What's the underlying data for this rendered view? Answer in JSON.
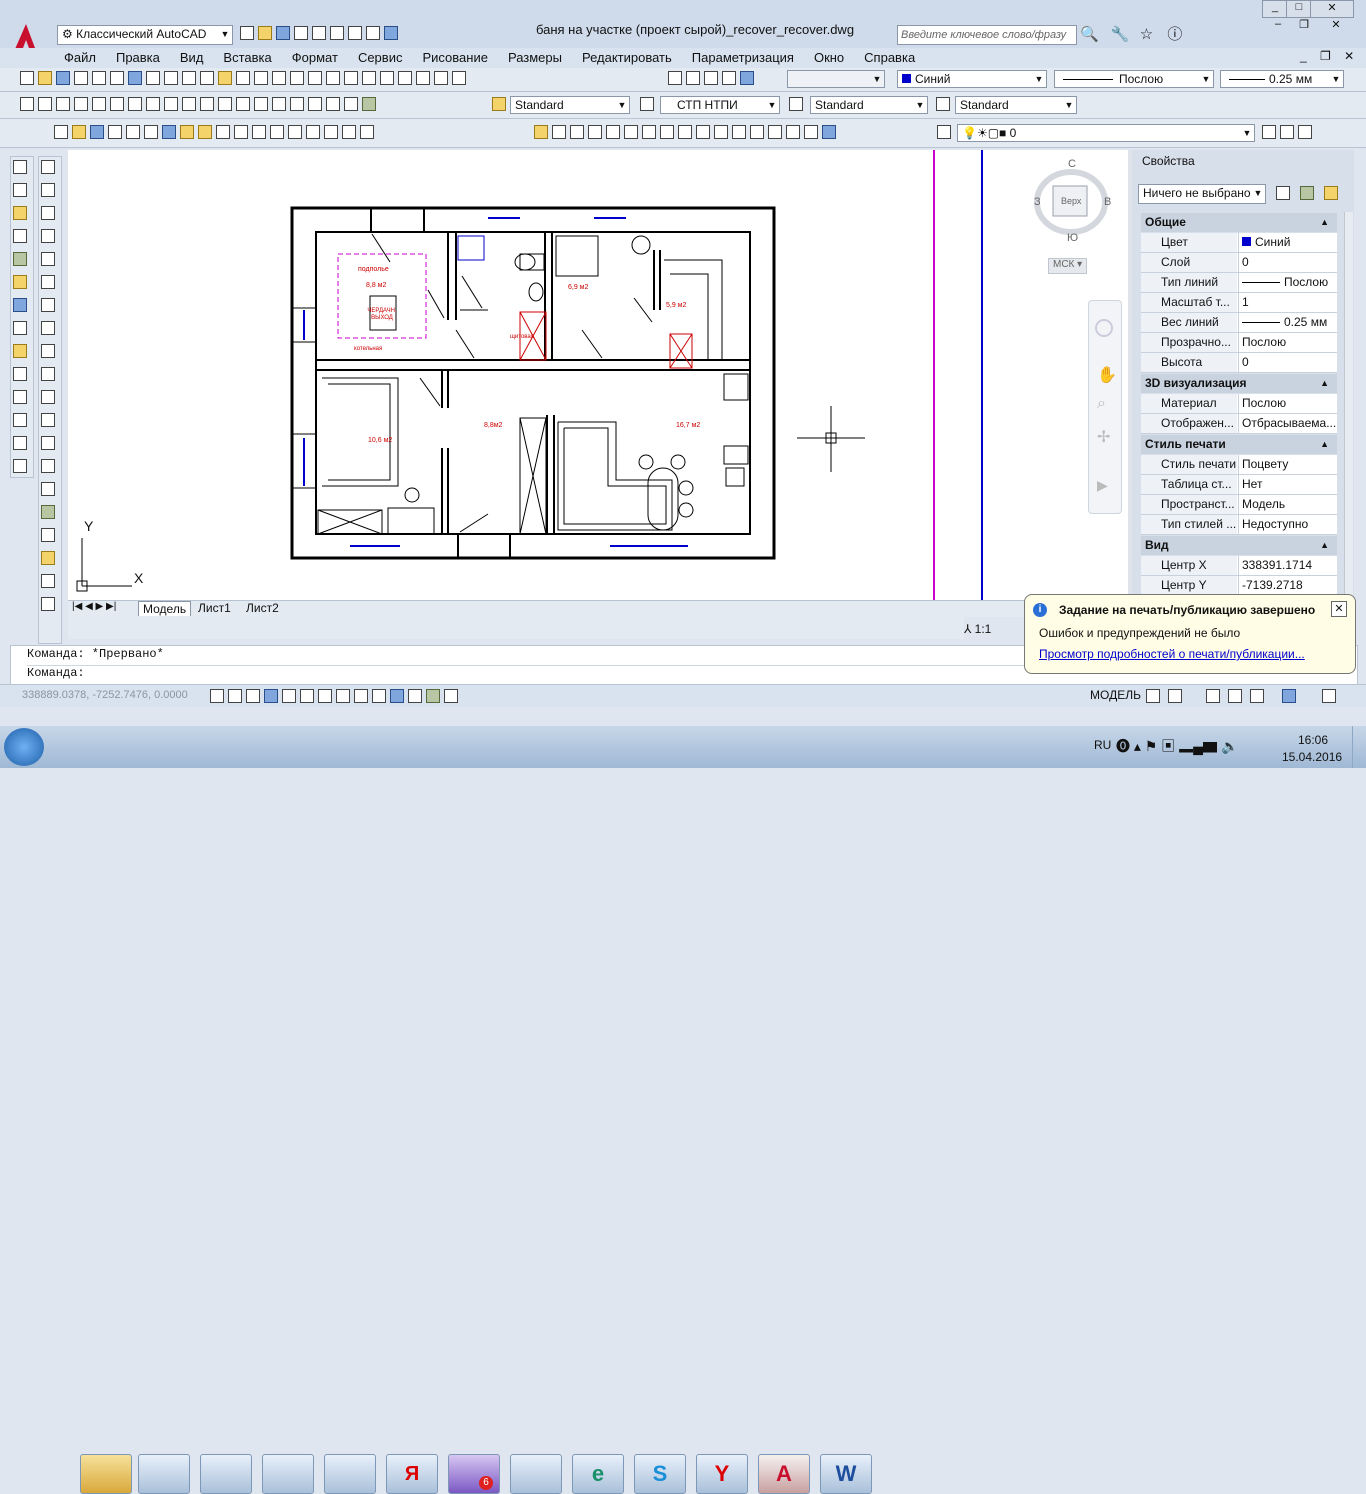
{
  "window": {
    "title": "баня на участке (проект сырой)_recover_recover.dwg",
    "workspace": "Классический AutoCAD",
    "search_placeholder": "Введите ключевое слово/фразу"
  },
  "menu": [
    "Файл",
    "Правка",
    "Вид",
    "Вставка",
    "Формат",
    "Сервис",
    "Рисование",
    "Размеры",
    "Редактировать",
    "Параметризация",
    "Окно",
    "Справка"
  ],
  "props_toolbar": {
    "color": "Синий",
    "linetype": "Послою",
    "lineweight": "0.25 мм"
  },
  "styles_toolbar": {
    "text_style": "Standard",
    "dim_style": "СТП НТПИ",
    "table_style": "Standard",
    "mleader_style": "Standard"
  },
  "layer_toolbar": {
    "layer": "0"
  },
  "tabs": [
    "Модель",
    "Лист1",
    "Лист2"
  ],
  "viewcube": {
    "north": "С",
    "south": "Ю",
    "west": "З",
    "east": "В",
    "top": "Верх",
    "ucs": "МСК"
  },
  "ucs": {
    "x": "X",
    "y": "Y"
  },
  "annotation_scale": "1:1",
  "drawing_labels": {
    "podpolie": "подполье",
    "area1": "8,8 м2",
    "hatch": "ЧЕРДАЧН. ВЫХОД",
    "kotelnaya": "котельная",
    "schitovaya": "щитовая",
    "area2": "6,9 м2",
    "area3": "5,9 м2",
    "area4": "10,6 м2",
    "area5": "8,8м2",
    "area6": "16,7 м2"
  },
  "properties": {
    "title": "Свойства",
    "selection": "Ничего не выбрано",
    "sections": [
      {
        "name": "Общие",
        "rows": [
          {
            "k": "Цвет",
            "v": "Синий"
          },
          {
            "k": "Слой",
            "v": "0"
          },
          {
            "k": "Тип линий",
            "v": "Послою"
          },
          {
            "k": "Масштаб т...",
            "v": "1"
          },
          {
            "k": "Вес линий",
            "v": "0.25 мм"
          },
          {
            "k": "Прозрачно...",
            "v": "Послою"
          },
          {
            "k": "Высота",
            "v": "0"
          }
        ]
      },
      {
        "name": "3D визуализация",
        "rows": [
          {
            "k": "Материал",
            "v": "Послою"
          },
          {
            "k": "Отображен...",
            "v": "Отбрасываема..."
          }
        ]
      },
      {
        "name": "Стиль печати",
        "rows": [
          {
            "k": "Стиль печати",
            "v": "Поцвету"
          },
          {
            "k": "Таблица ст...",
            "v": "Нет"
          },
          {
            "k": "Пространст...",
            "v": "Модель"
          },
          {
            "k": "Тип стилей ...",
            "v": "Недоступно"
          }
        ]
      },
      {
        "name": "Вид",
        "rows": [
          {
            "k": "Центр X",
            "v": "338391.1714"
          },
          {
            "k": "Центр Y",
            "v": "-7139.2718"
          }
        ]
      }
    ]
  },
  "command": {
    "line1": "Команда: *Прервано*",
    "line2": "Команда:"
  },
  "status": {
    "coords": "338889.0378, -7252.7476, 0.0000",
    "model": "МОДЕЛЬ"
  },
  "notification": {
    "title": "Задание на печать/публикацию завершено",
    "body": "Ошибок и предупреждений не было",
    "link": "Просмотр подробностей о печати/публикации..."
  },
  "taskbar": {
    "lang": "RU",
    "time": "16:06",
    "date": "15.04.2016",
    "viber_badge": "6"
  },
  "colors": {
    "accent_blue": "#0000cc",
    "magenta": "#cc00cc",
    "red": "#cc0000"
  }
}
